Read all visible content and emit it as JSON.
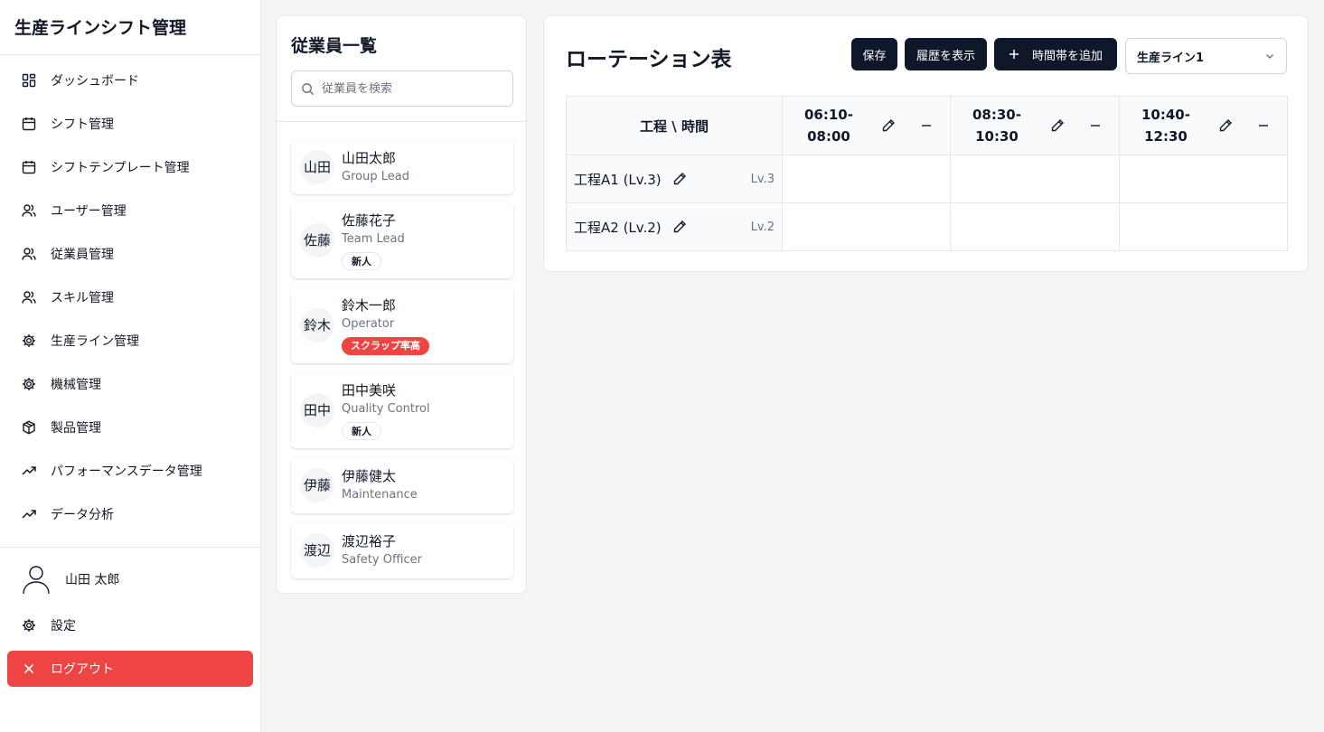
{
  "app": {
    "title": "生産ラインシフト管理"
  },
  "sidebar": {
    "items": [
      {
        "label": "ダッシュボード",
        "icon": "dashboard-icon"
      },
      {
        "label": "シフト管理",
        "icon": "calendar-icon"
      },
      {
        "label": "シフトテンプレート管理",
        "icon": "calendar-icon"
      },
      {
        "label": "ユーザー管理",
        "icon": "users-icon"
      },
      {
        "label": "従業員管理",
        "icon": "users-icon"
      },
      {
        "label": "スキル管理",
        "icon": "users-icon"
      },
      {
        "label": "生産ライン管理",
        "icon": "gear-icon"
      },
      {
        "label": "機械管理",
        "icon": "gear-icon"
      },
      {
        "label": "製品管理",
        "icon": "package-icon"
      },
      {
        "label": "パフォーマンスデータ管理",
        "icon": "trending-up-icon"
      },
      {
        "label": "データ分析",
        "icon": "trending-up-icon"
      }
    ],
    "user_name": "山田 太郎",
    "settings_label": "設定",
    "logout_label": "ログアウト"
  },
  "employees": {
    "title": "従業員一覧",
    "search_placeholder": "従業員を検索",
    "list": [
      {
        "avatar": "山田",
        "name": "山田太郎",
        "role": "Group Lead"
      },
      {
        "avatar": "佐藤",
        "name": "佐藤花子",
        "role": "Team Lead",
        "badge": "新人",
        "badge_type": "new"
      },
      {
        "avatar": "鈴木",
        "name": "鈴木一郎",
        "role": "Operator",
        "badge": "スクラップ率高",
        "badge_type": "alert"
      },
      {
        "avatar": "田中",
        "name": "田中美咲",
        "role": "Quality Control",
        "badge": "新人",
        "badge_type": "new"
      },
      {
        "avatar": "伊藤",
        "name": "伊藤健太",
        "role": "Maintenance"
      },
      {
        "avatar": "渡辺",
        "name": "渡辺裕子",
        "role": "Safety Officer"
      }
    ]
  },
  "rotation": {
    "title": "ローテーション表",
    "save_label": "保存",
    "history_label": "履歴を表示",
    "add_slot_label": "時間帯を追加",
    "line_selected": "生産ライン1",
    "corner_header": "工程 \\ 時間",
    "time_slots": [
      {
        "line1": "06:10-",
        "line2": "08:00"
      },
      {
        "line1": "08:30-",
        "line2": "10:30"
      },
      {
        "line1": "10:40-",
        "line2": "12:30"
      }
    ],
    "processes": [
      {
        "name": "工程A1 (Lv.3)",
        "level": "Lv.3"
      },
      {
        "name": "工程A2 (Lv.2)",
        "level": "Lv.2"
      }
    ]
  },
  "colors": {
    "accent_dark": "#0f172a",
    "danger": "#ef4444",
    "background": "#f3f4f6"
  }
}
